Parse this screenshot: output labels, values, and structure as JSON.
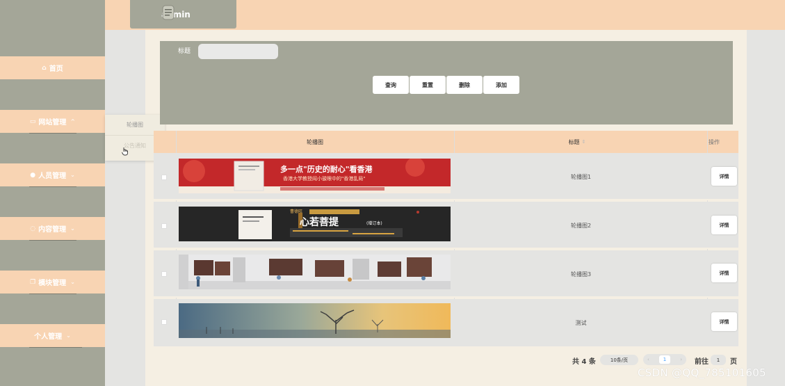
{
  "header": {
    "username": "admin"
  },
  "sidebar": {
    "items": [
      {
        "label": "首页",
        "icon": "home-icon"
      },
      {
        "label": "网站管理",
        "icon": "monitor-icon"
      },
      {
        "label": "人员管理",
        "icon": "user-icon"
      },
      {
        "label": "内容管理",
        "icon": "chat-icon"
      },
      {
        "label": "模块管理",
        "icon": "copy-icon"
      },
      {
        "label": "个人管理",
        "icon": ""
      }
    ],
    "submenu": [
      "轮播图",
      "公告通知"
    ]
  },
  "search": {
    "title_label": "标题",
    "title_value": "",
    "buttons": {
      "query": "查询",
      "reset": "重置",
      "delete": "删除",
      "add": "添加"
    }
  },
  "table": {
    "headers": {
      "image": "轮播图",
      "title": "标题",
      "actions": "操作"
    },
    "rows": [
      {
        "title": "轮播图1",
        "action": "详情"
      },
      {
        "title": "轮播图2",
        "action": "详情"
      },
      {
        "title": "轮播图3",
        "action": "详情"
      },
      {
        "title": "测试",
        "action": "详情"
      }
    ],
    "banners": {
      "b1_headline": "多一点\"历史的耐心\"看香港",
      "b1_sub": "香港大学教授阎小骏眼中的\"香港乱局\"",
      "b2_small": "曹德旺",
      "b2_headline": "心若菩提",
      "b2_tag": "(增订本)"
    }
  },
  "pagination": {
    "total": "共 4 条",
    "page_size": "10条/页",
    "prev": "‹",
    "current": "1",
    "next": "›",
    "goto_label": "前往",
    "goto_value": "1",
    "goto_suffix": "页"
  },
  "watermark": "CSDN @QQ_785101605",
  "colors": {
    "accent": "#f8d4b3",
    "sidebar": "#a4a698",
    "panel": "#f5efe3"
  }
}
